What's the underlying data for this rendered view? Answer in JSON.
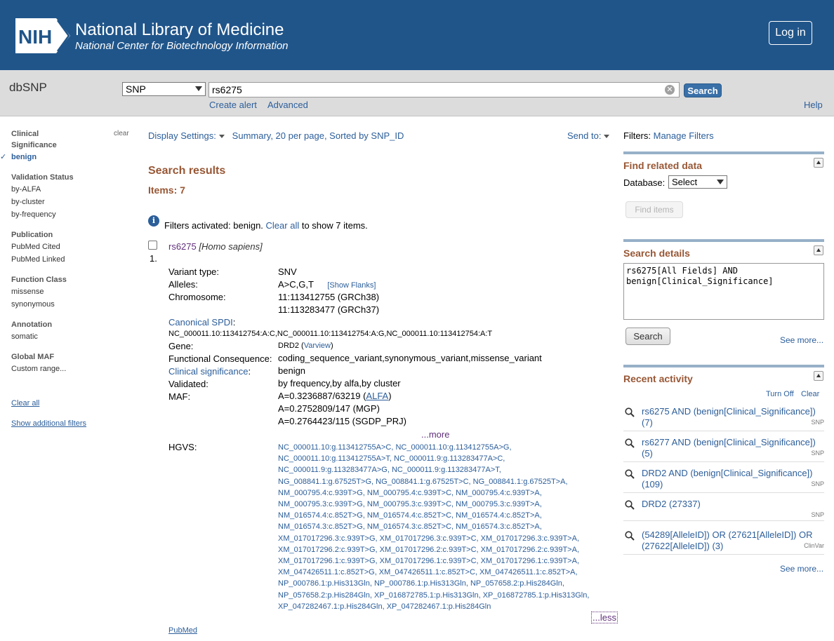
{
  "header": {
    "org_name": "National Library of Medicine",
    "org_sub": "National Center for Biotechnology Information",
    "logo_text": "NIH",
    "login": "Log in"
  },
  "searchbar": {
    "db_name": "dbSNP",
    "db_select": "SNP",
    "term": "rs6275",
    "search": "Search",
    "create_alert": "Create alert",
    "advanced": "Advanced",
    "help": "Help"
  },
  "sidebar": {
    "clear": "clear",
    "groups": [
      {
        "title": "Clinical Significance",
        "items": [
          "benign"
        ]
      },
      {
        "title": "Validation Status",
        "items": [
          "by-ALFA",
          "by-cluster",
          "by-frequency"
        ]
      },
      {
        "title": "Publication",
        "items": [
          "PubMed Cited",
          "PubMed Linked"
        ]
      },
      {
        "title": "Function Class",
        "items": [
          "missense",
          "synonymous"
        ]
      },
      {
        "title": "Annotation",
        "items": [
          "somatic"
        ]
      },
      {
        "title": "Global MAF",
        "items": [
          "Custom range..."
        ]
      }
    ],
    "clear_all": "Clear all",
    "show_filters": "Show additional filters"
  },
  "main": {
    "display_settings": "Display Settings:",
    "display_value": "Summary, 20 per page, Sorted by SNP_ID",
    "send_to": "Send to:",
    "results_title": "Search results",
    "items": "Items: 7",
    "filters_prefix": "Filters activated: benign.",
    "filters_clear": "Clear all",
    "filters_suffix": "to show 7 items.",
    "result": {
      "num": "1.",
      "id": "rs6275",
      "org": "[Homo sapiens]",
      "variant_type_label": "Variant type:",
      "variant_type": "SNV",
      "alleles_label": "Alleles:",
      "alleles": "A>C,G,T",
      "show_flanks": "[Show Flanks]",
      "chromosome_label": "Chromosome:",
      "chrom_38": "11:113412755 (GRCh38)",
      "chrom_37": "11:113283477 (GRCh37)",
      "spdi_label": "Canonical SPDI",
      "spdi": "NC_000011.10:113412754:A:C,NC_000011.10:113412754:A:G,NC_000011.10:113412754:A:T",
      "gene_label": "Gene:",
      "gene": "DRD2",
      "varview": "Varview",
      "consequence_label": "Functional Consequence:",
      "consequence": "coding_sequence_variant,synonymous_variant,missense_variant",
      "clinsig_label": "Clinical significance",
      "clinsig": "benign",
      "validated_label": "Validated:",
      "validated": "by frequency,by alfa,by cluster",
      "maf_label": "MAF:",
      "maf_1_prefix": "A=0.3236887/63219 (",
      "maf_1_link": "ALFA",
      "maf_1_suffix": ")",
      "maf_2": "A=0.2752809/147 (MGP)",
      "maf_3": "A=0.2764423/115 (SGDP_PRJ)",
      "more": "...more",
      "hgvs_label": "HGVS:",
      "hgvs": [
        "NC_000011.10:g.113412755A>C, NC_000011.10:g.113412755A>G,",
        "NC_000011.10:g.113412755A>T, NC_000011.9:g.113283477A>C,",
        "NC_000011.9:g.113283477A>G, NC_000011.9:g.113283477A>T,",
        "NG_008841.1:g.67525T>G, NG_008841.1:g.67525T>C, NG_008841.1:g.67525T>A,",
        "NM_000795.4:c.939T>G, NM_000795.4:c.939T>C, NM_000795.4:c.939T>A,",
        "NM_000795.3:c.939T>G, NM_000795.3:c.939T>C, NM_000795.3:c.939T>A,",
        "NM_016574.4:c.852T>G, NM_016574.4:c.852T>C, NM_016574.4:c.852T>A,",
        "NM_016574.3:c.852T>G, NM_016574.3:c.852T>C, NM_016574.3:c.852T>A,",
        "XM_017017296.3:c.939T>G, XM_017017296.3:c.939T>C, XM_017017296.3:c.939T>A,",
        "XM_017017296.2:c.939T>G, XM_017017296.2:c.939T>C, XM_017017296.2:c.939T>A,",
        "XM_017017296.1:c.939T>G, XM_017017296.1:c.939T>C, XM_017017296.1:c.939T>A,",
        "XM_047426511.1:c.852T>G, XM_047426511.1:c.852T>C, XM_047426511.1:c.852T>A,",
        "NP_000786.1:p.His313Gln, NP_000786.1:p.His313Gln, NP_057658.2:p.His284Gln,",
        "NP_057658.2:p.His284Gln, XP_016872785.1:p.His313Gln, XP_016872785.1:p.His313Gln,",
        "XP_047282467.1:p.His284Gln, XP_047282467.1:p.His284Gln"
      ],
      "less": "...less",
      "pubmed": "PubMed"
    }
  },
  "right": {
    "filters_label": "Filters:",
    "manage_filters": "Manage Filters",
    "find_related": "Find related data",
    "database_label": "Database:",
    "database_select": "Select",
    "find_items": "Find items",
    "search_details": "Search details",
    "details_text": "rs6275[All Fields] AND\nbenign[Clinical_Significance]",
    "details_search": "Search",
    "see_more": "See more...",
    "recent_title": "Recent activity",
    "turn_off": "Turn Off",
    "clear": "Clear",
    "recent": [
      {
        "text": "rs6275 AND (benign[Clinical_Significance]) (7)",
        "db": "SNP"
      },
      {
        "text": "rs6277 AND (benign[Clinical_Significance]) (5)",
        "db": "SNP"
      },
      {
        "text": "DRD2 AND (benign[Clinical_Significance]) (109)",
        "db": "SNP"
      },
      {
        "text": "DRD2 (27337)",
        "db": "SNP"
      },
      {
        "text": "(54289[AlleleID]) OR (27621[AlleleID]) OR (27622[AlleleID]) (3)",
        "db": "ClinVar"
      }
    ],
    "see_more_2": "See more..."
  },
  "colors": {
    "header_bg": "#20558a",
    "link": "#2c5e9a",
    "section_title": "#985735",
    "visited": "#60307a"
  }
}
